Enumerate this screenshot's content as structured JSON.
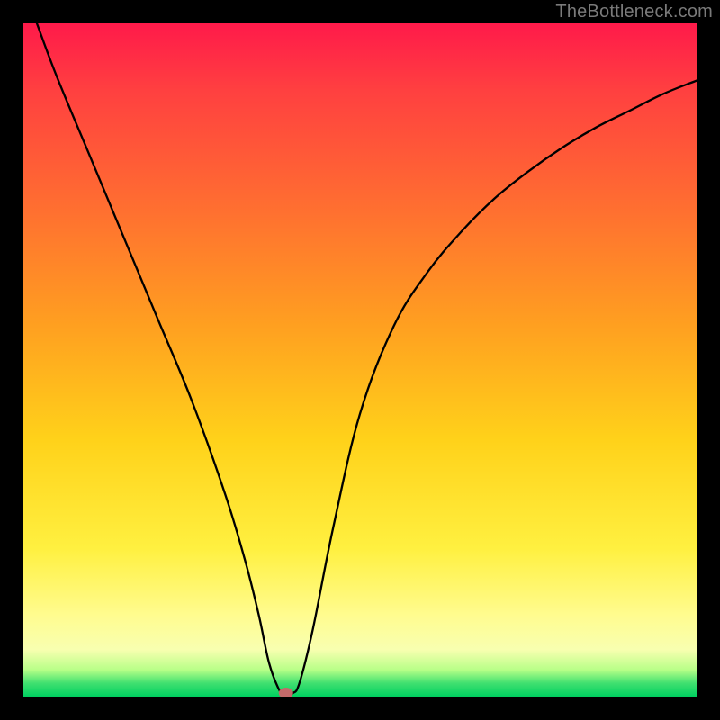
{
  "watermark": "TheBottleneck.com",
  "chart_data": {
    "type": "line",
    "title": "",
    "xlabel": "",
    "ylabel": "",
    "xlim": [
      0,
      100
    ],
    "ylim": [
      0,
      100
    ],
    "grid": false,
    "series": [
      {
        "name": "curve",
        "x": [
          2,
          5,
          10,
          15,
          20,
          25,
          30,
          33,
          35,
          36.5,
          38,
          39,
          40,
          41,
          43,
          46,
          50,
          55,
          60,
          65,
          70,
          75,
          80,
          85,
          90,
          95,
          100
        ],
        "y": [
          100,
          92,
          80,
          68,
          56,
          44,
          30,
          20,
          12,
          5,
          1,
          0,
          0.5,
          2,
          10,
          25,
          42,
          55,
          63,
          69,
          74,
          78,
          81.5,
          84.5,
          87,
          89.5,
          91.5
        ]
      }
    ],
    "minimum_marker": {
      "x": 39,
      "y": 0,
      "color": "#c46a6a"
    },
    "background_gradient_stops": [
      {
        "pos": 0.0,
        "color": "#ff1a4a"
      },
      {
        "pos": 0.28,
        "color": "#ff7030"
      },
      {
        "pos": 0.62,
        "color": "#ffd21a"
      },
      {
        "pos": 0.88,
        "color": "#fffc90"
      },
      {
        "pos": 1.0,
        "color": "#00d060"
      }
    ]
  }
}
